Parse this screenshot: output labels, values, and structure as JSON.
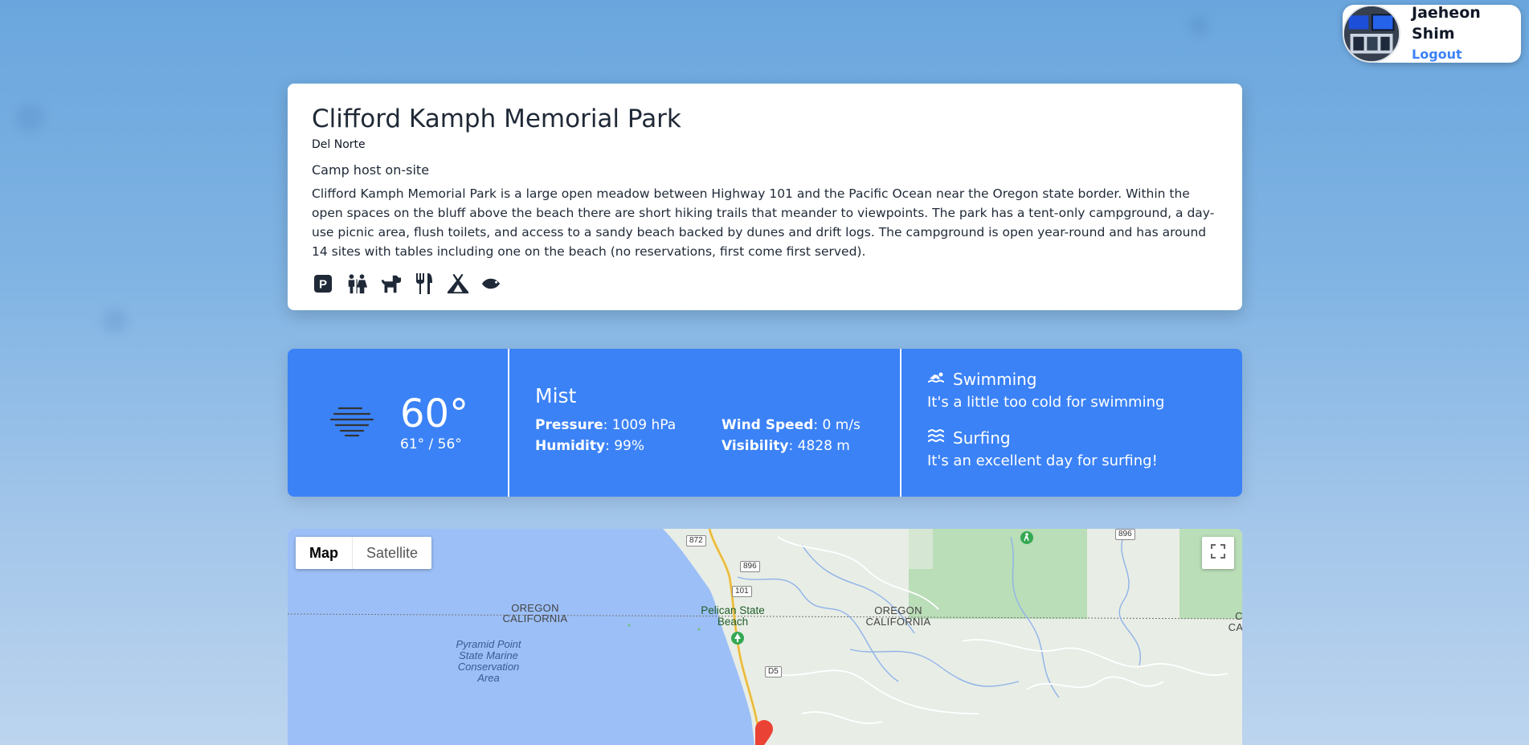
{
  "user": {
    "name": "Jaeheon Shim",
    "logout_label": "Logout"
  },
  "park": {
    "title": "Clifford Kamph Memorial Park",
    "region": "Del Norte",
    "host_note": "Camp host on-site",
    "description": "Clifford Kamph Memorial Park is a large open meadow between Highway 101 and the Pacific Ocean near the Oregon state border. Within the open spaces on the bluff above the beach there are short hiking trails that meander to viewpoints. The park has a tent-only campground, a day-use picnic area, flush toilets, and access to a sandy beach backed by dunes and drift logs. The campground is open year-round and has around 14 sites with tables including one on the beach (no reservations, first come first served).",
    "amenities": [
      "parking-icon",
      "restroom-icon",
      "dog-icon",
      "utensils-icon",
      "campground-icon",
      "fish-icon"
    ]
  },
  "weather": {
    "icon": "mist-icon",
    "temp": "60°",
    "range": "61° / 56°",
    "condition": "Mist",
    "pressure_label": "Pressure",
    "pressure_value": ": 1009 hPa",
    "humidity_label": "Humidity",
    "humidity_value": ": 99%",
    "wind_label": "Wind Speed",
    "wind_value": ": 0 m/s",
    "visibility_label": "Visibility",
    "visibility_value": ": 4828 m",
    "swimming_title": "Swimming",
    "swimming_text": "It's a little too cold for swimming",
    "surfing_title": "Surfing",
    "surfing_text": "It's an excellent day for surfing!",
    "color": "#3b82f6"
  },
  "map": {
    "type_map": "Map",
    "type_satellite": "Satellite",
    "labels": {
      "oregon_1": "OREGON",
      "california_1": "CALIFORNIA",
      "oregon_2": "OREGON",
      "california_2": "CALIFORNIA",
      "edge_c": "C",
      "edge_ca": "CA",
      "ocean_area": "Pyramid Point State Marine Conservation Area",
      "beach": "Pelican State Beach"
    },
    "shields": {
      "r872": "872",
      "r896a": "896",
      "r896b": "896",
      "r101": "101",
      "d5": "D5"
    }
  }
}
